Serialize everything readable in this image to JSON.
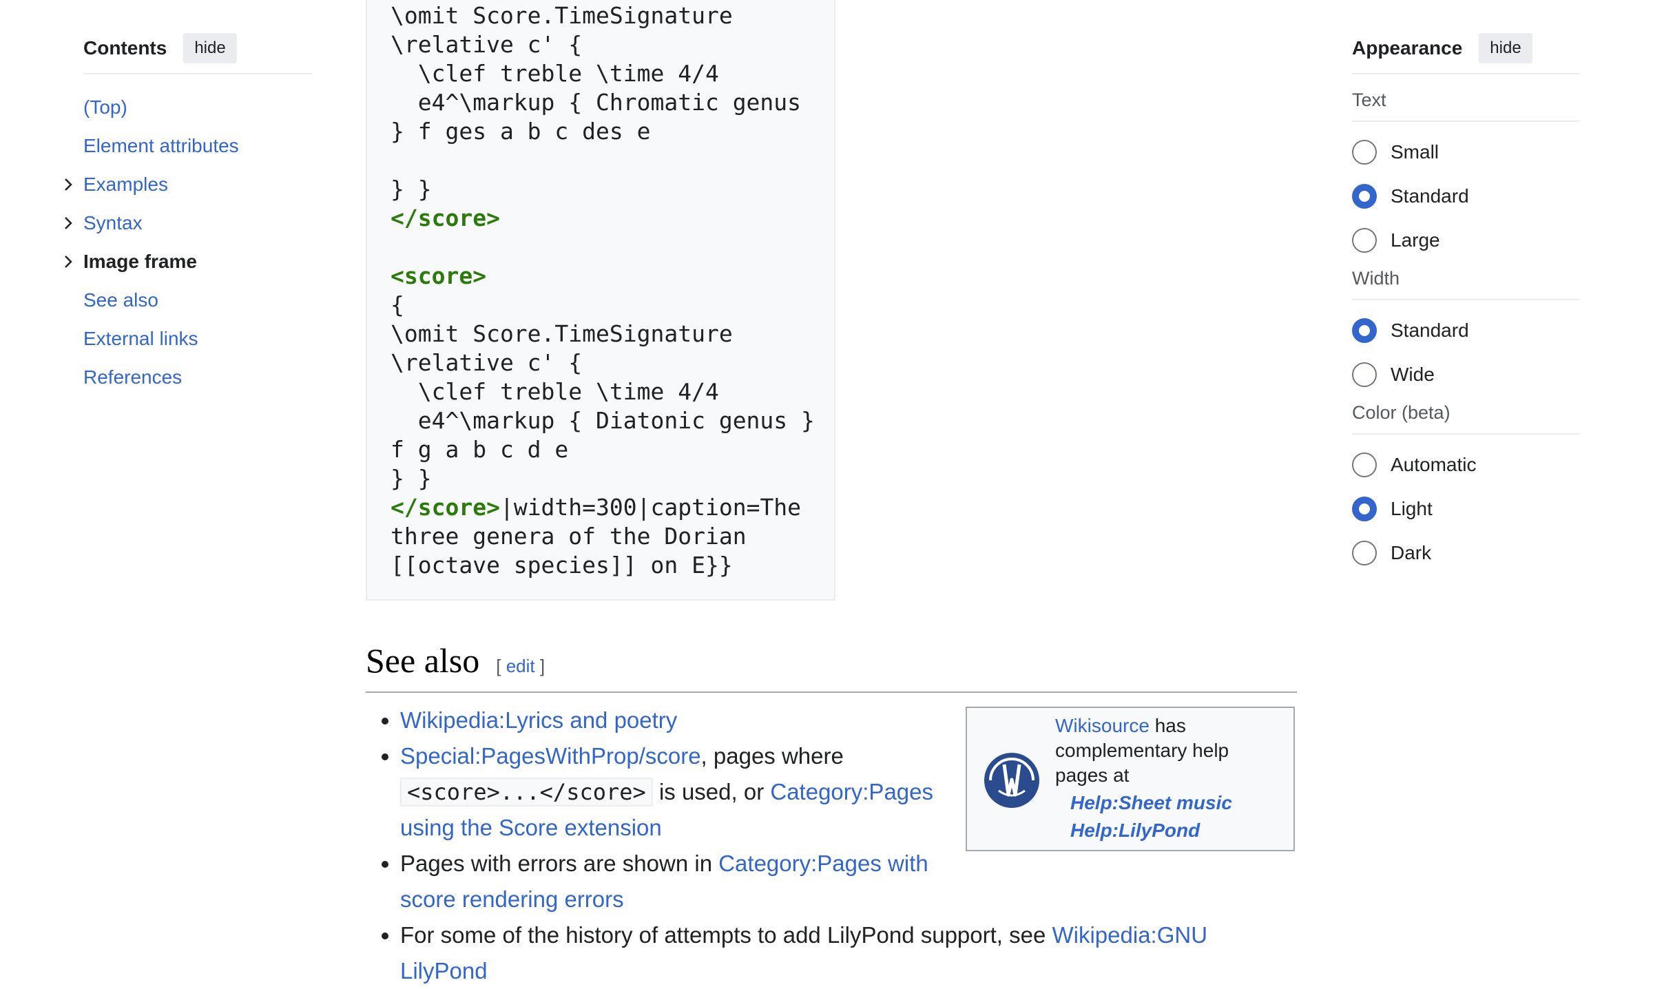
{
  "toc": {
    "title": "Contents",
    "hide_label": "hide",
    "items": [
      {
        "label": "(Top)",
        "expandable": false,
        "current": false
      },
      {
        "label": "Element attributes",
        "expandable": false,
        "current": false
      },
      {
        "label": "Examples",
        "expandable": true,
        "current": false
      },
      {
        "label": "Syntax",
        "expandable": true,
        "current": false
      },
      {
        "label": "Image frame",
        "expandable": true,
        "current": true
      },
      {
        "label": "See also",
        "expandable": false,
        "current": false
      },
      {
        "label": "External links",
        "expandable": false,
        "current": false
      },
      {
        "label": "References",
        "expandable": false,
        "current": false
      }
    ]
  },
  "code_block": {
    "lines": [
      {
        "text": "\\omit Score.TimeSignature"
      },
      {
        "text": "\\relative c' {"
      },
      {
        "text": "  \\clef treble \\time 4/4"
      },
      {
        "text": "  e4^\\markup { Chromatic genus"
      },
      {
        "text": "} f ges a b c des e"
      },
      {
        "text": ""
      },
      {
        "text": "} }"
      },
      {
        "text": "</score>",
        "tag": true
      },
      {
        "text": ""
      },
      {
        "text": "<score>",
        "tag": true
      },
      {
        "text": "{"
      },
      {
        "text": "\\omit Score.TimeSignature"
      },
      {
        "text": "\\relative c' {"
      },
      {
        "text": "  \\clef treble \\time 4/4"
      },
      {
        "text": "  e4^\\markup { Diatonic genus }"
      },
      {
        "text": "f g a b c d e"
      },
      {
        "text": "} }"
      },
      {
        "text": "</score>",
        "tag": true,
        "rest": "|width=300|caption=The"
      },
      {
        "text": "three genera of the Dorian"
      },
      {
        "text": "[[octave species]] on E}}"
      }
    ]
  },
  "see_also": {
    "heading": "See also",
    "edit_label": "edit",
    "items": {
      "lyrics_link": "Wikipedia:Lyrics and poetry",
      "pageswithprop_link": "Special:PagesWithProp/score",
      "pageswithprop_text": ", pages where",
      "code_text": "<score>...</score>",
      "is_used_text": " is used, or ",
      "category_link": "Category:Pages using the Score extension",
      "errors_text": "Pages with errors are shown in ",
      "errors_link": "Category:Pages with score rendering errors",
      "history_text": "For some of the history of attempts to add LilyPond support, see ",
      "history_link": "Wikipedia:GNU LilyPond"
    }
  },
  "sister": {
    "link": "Wikisource",
    "text1": " has complementary help pages at",
    "help1": "Help:Sheet music",
    "help2": "Help:LilyPond",
    "logo_icon": "wikisource-logo-icon"
  },
  "appearance": {
    "title": "Appearance",
    "hide_label": "hide",
    "text_label": "Text",
    "text_options": [
      "Small",
      "Standard",
      "Large"
    ],
    "text_selected": "Standard",
    "width_label": "Width",
    "width_options": [
      "Standard",
      "Wide"
    ],
    "width_selected": "Standard",
    "color_label": "Color (beta)",
    "color_options": [
      "Automatic",
      "Light",
      "Dark"
    ],
    "color_selected": "Light",
    "accent_color": "#3366cc"
  }
}
